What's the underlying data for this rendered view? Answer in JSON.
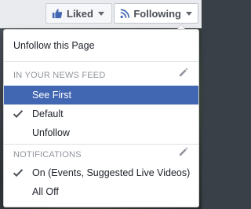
{
  "header": {
    "liked_label": "Liked",
    "following_label": "Following"
  },
  "menu": {
    "unfollow_page_label": "Unfollow this Page",
    "news_feed": {
      "header": "IN YOUR NEWS FEED",
      "items": [
        {
          "label": "See First",
          "checked": false,
          "highlighted": true
        },
        {
          "label": "Default",
          "checked": true,
          "highlighted": false
        },
        {
          "label": "Unfollow",
          "checked": false,
          "highlighted": false
        }
      ]
    },
    "notifications": {
      "header": "NOTIFICATIONS",
      "items": [
        {
          "label": "On (Events, Suggested Live Videos)",
          "checked": true,
          "highlighted": false
        },
        {
          "label": "All Off",
          "checked": false,
          "highlighted": false
        }
      ]
    }
  },
  "colors": {
    "highlight": "#4267b2",
    "header_text": "#90949c"
  },
  "icons": {
    "liked": "thumbs-up-icon",
    "following": "rss-icon",
    "dropdown": "caret-down-icon",
    "edit": "pencil-icon",
    "checked": "checkmark-icon"
  }
}
